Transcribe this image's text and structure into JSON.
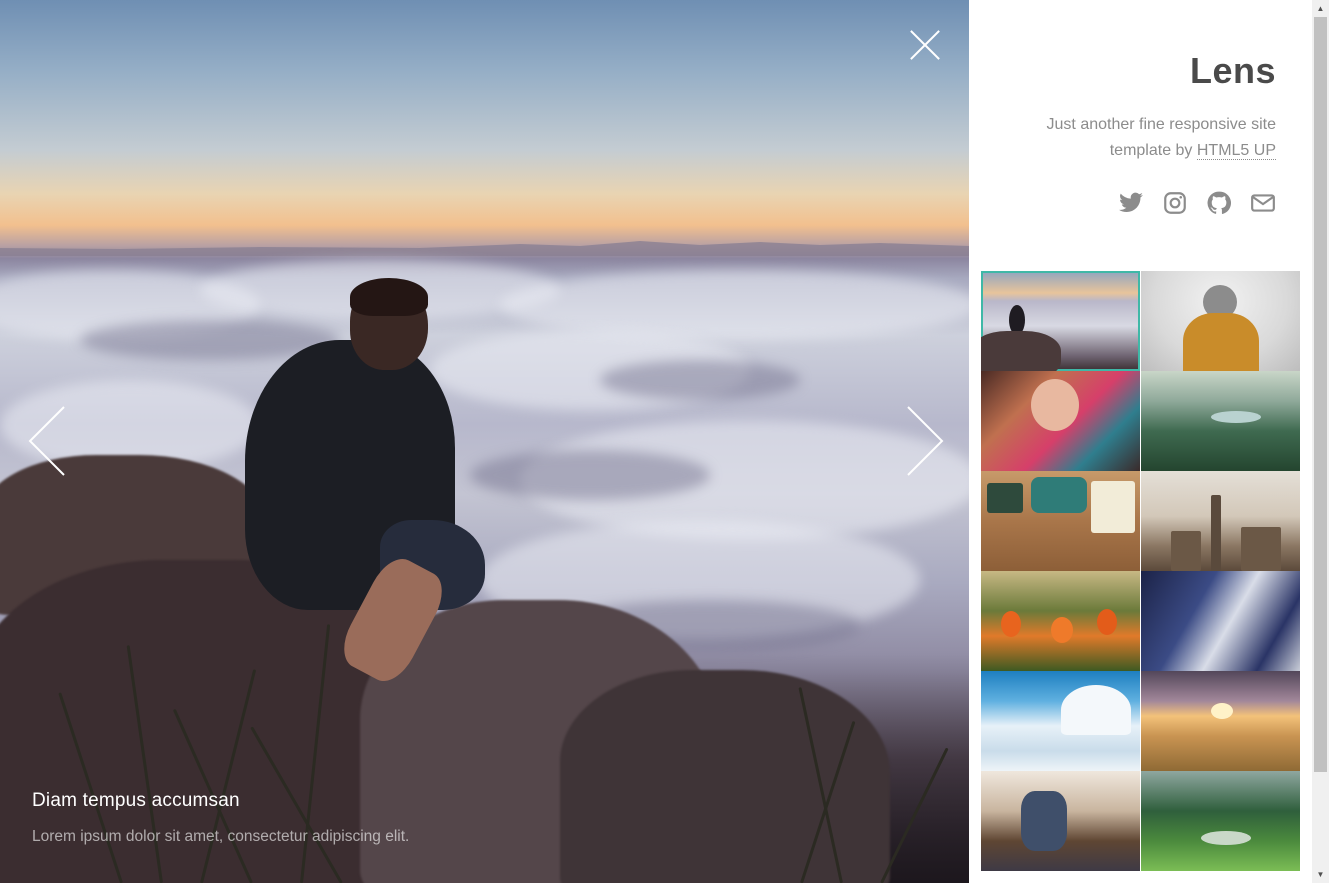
{
  "viewer": {
    "caption_title": "Diam tempus accumsan",
    "caption_text": "Lorem ipsum dolor sit amet, consectetur adipiscing elit.",
    "close_icon": "close-icon",
    "prev_icon": "chevron-left-icon",
    "next_icon": "chevron-right-icon"
  },
  "sidebar": {
    "title": "Lens",
    "description_prefix": "Just another fine responsive site template by ",
    "description_link": "HTML5 UP",
    "social": [
      "twitter-icon",
      "instagram-icon",
      "github-icon",
      "envelope-icon"
    ],
    "accent_color": "#3fb8a7",
    "thumbnails": [
      {
        "subject": "man-above-clouds",
        "active": true
      },
      {
        "subject": "person-in-beanie"
      },
      {
        "subject": "woman-with-scarf"
      },
      {
        "subject": "green-valley"
      },
      {
        "subject": "typewriter-desk"
      },
      {
        "subject": "city-skyline"
      },
      {
        "subject": "orange-tulips"
      },
      {
        "subject": "glass-building"
      },
      {
        "subject": "snowy-mountain"
      },
      {
        "subject": "sunset-field"
      },
      {
        "subject": "person-on-stool"
      },
      {
        "subject": "green-mountains"
      }
    ]
  }
}
